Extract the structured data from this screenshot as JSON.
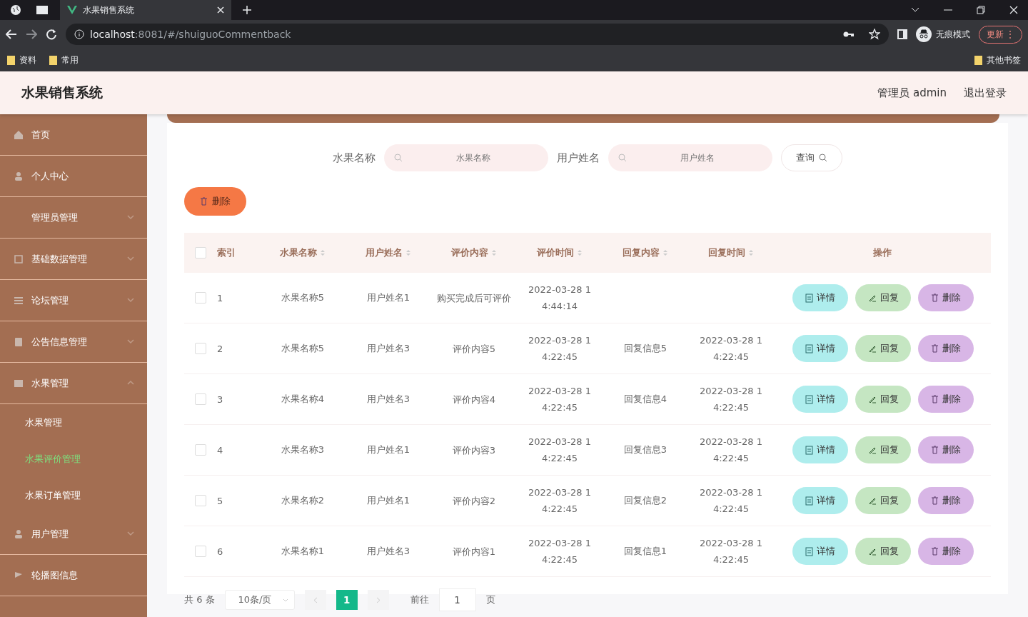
{
  "browser": {
    "tab_title": "水果销售系统",
    "url_host": "localhost",
    "url_path": ":8081/#/shuiguoCommentback",
    "profile": "无痕模式",
    "update": "更新",
    "menu": "⋮",
    "bookmarks": [
      "资料",
      "常用"
    ],
    "other_bookmarks": "其他书签"
  },
  "header": {
    "title": "水果销售系统",
    "user": "管理员 admin",
    "logout": "退出登录"
  },
  "sidebar": {
    "items": [
      {
        "label": "首页"
      },
      {
        "label": "个人中心"
      },
      {
        "label": "管理员管理",
        "expanded": false
      },
      {
        "label": "基础数据管理",
        "expanded": false
      },
      {
        "label": "论坛管理",
        "expanded": false
      },
      {
        "label": "公告信息管理",
        "expanded": false
      },
      {
        "label": "水果管理",
        "expanded": true,
        "children": [
          {
            "label": "水果管理",
            "selected": false
          },
          {
            "label": "水果评价管理",
            "selected": true
          },
          {
            "label": "水果订单管理",
            "selected": false
          }
        ]
      },
      {
        "label": "用户管理",
        "expanded": false
      },
      {
        "label": "轮播图信息"
      }
    ]
  },
  "search": {
    "fields": [
      {
        "label": "水果名称",
        "placeholder": "水果名称"
      },
      {
        "label": "用户姓名",
        "placeholder": "用户姓名"
      }
    ],
    "button": "查询"
  },
  "bulk_delete": "删除",
  "table": {
    "select_all_checked": false,
    "columns": [
      {
        "label": "索引",
        "sortable": false
      },
      {
        "label": "水果名称",
        "sortable": true
      },
      {
        "label": "用户姓名",
        "sortable": true
      },
      {
        "label": "评价内容",
        "sortable": true
      },
      {
        "label": "评价时间",
        "sortable": true
      },
      {
        "label": "回复内容",
        "sortable": true
      },
      {
        "label": "回复时间",
        "sortable": true
      },
      {
        "label": "操作",
        "sortable": false
      }
    ],
    "rows": [
      {
        "checked": false,
        "cells": [
          "1",
          "水果名称5",
          "用户姓名1",
          "购买完成后可评价",
          "2022-03-28 14:44:14"
        ],
        "actions": [
          {
            "kind": "detail",
            "label": "详情"
          },
          {
            "kind": "reply",
            "label": "回复"
          },
          {
            "kind": "delete",
            "label": "删除"
          }
        ]
      },
      {
        "checked": false,
        "cells": [
          "2",
          "水果名称5",
          "用户姓名3",
          "评价内容5",
          "2022-03-28 14:22:45",
          "回复信息5",
          "2022-03-28 14:22:45"
        ],
        "actions": [
          {
            "kind": "detail",
            "label": "详情"
          },
          {
            "kind": "reply",
            "label": "回复"
          },
          {
            "kind": "delete",
            "label": "删除"
          }
        ]
      },
      {
        "checked": false,
        "cells": [
          "3",
          "水果名称4",
          "用户姓名3",
          "评价内容4",
          "2022-03-28 14:22:45",
          "回复信息4",
          "2022-03-28 14:22:45"
        ],
        "actions": [
          {
            "kind": "detail",
            "label": "详情"
          },
          {
            "kind": "reply",
            "label": "回复"
          },
          {
            "kind": "delete",
            "label": "删除"
          }
        ]
      },
      {
        "checked": false,
        "cells": [
          "4",
          "水果名称3",
          "用户姓名1",
          "评价内容3",
          "2022-03-28 14:22:45",
          "回复信息3",
          "2022-03-28 14:22:45"
        ],
        "actions": [
          {
            "kind": "detail",
            "label": "详情"
          },
          {
            "kind": "reply",
            "label": "回复"
          },
          {
            "kind": "delete",
            "label": "删除"
          }
        ]
      },
      {
        "checked": false,
        "cells": [
          "5",
          "水果名称2",
          "用户姓名1",
          "评价内容2",
          "2022-03-28 14:22:45",
          "回复信息2",
          "2022-03-28 14:22:45"
        ],
        "actions": [
          {
            "kind": "detail",
            "label": "详情"
          },
          {
            "kind": "reply",
            "label": "回复"
          },
          {
            "kind": "delete",
            "label": "删除"
          }
        ]
      },
      {
        "checked": false,
        "cells": [
          "6",
          "水果名称1",
          "用户姓名3",
          "评价内容1",
          "2022-03-28 14:22:45",
          "回复信息1",
          "2022-03-28 14:22:45"
        ],
        "actions": [
          {
            "kind": "detail",
            "label": "详情"
          },
          {
            "kind": "reply",
            "label": "回复"
          },
          {
            "kind": "delete",
            "label": "删除"
          }
        ]
      }
    ]
  },
  "pagination": {
    "total": "共 6 条",
    "page_size": "10条/页",
    "pages": [
      {
        "label": "1",
        "selected": true
      }
    ],
    "goto_label": "前往",
    "goto_value": "1",
    "goto_suffix": "页"
  }
}
